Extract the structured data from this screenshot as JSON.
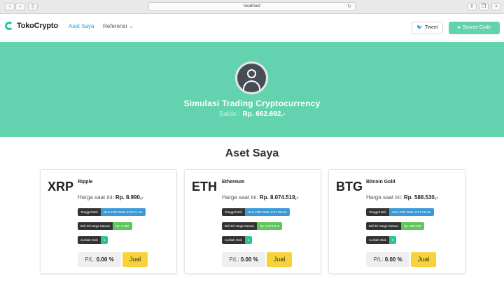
{
  "browser": {
    "address": "localhost"
  },
  "nav": {
    "logo": "TokoCrypto",
    "links": [
      "Aset Saya",
      "Referensi"
    ],
    "tweet": "Tweet",
    "source": "Source Code"
  },
  "hero": {
    "title": "Simulasi Trading Cryptocurrency",
    "saldo_label": "Saldo :",
    "saldo_value": "Rp. 662.692,-"
  },
  "section_title": "Aset Saya",
  "labels": {
    "price": "Harga saat ini:",
    "date": "Tanggal Beli",
    "buy_price": "Beli Di Harga Satuan",
    "count": "Jumlah Stok",
    "pl": "P/L:",
    "sell": "Jual"
  },
  "assets": [
    {
      "symbol": "XRP",
      "name": "Ripple",
      "price": "Rp. 8.990,-",
      "date": "June 10th 2018, 8:20:47 am",
      "buy_price": "Rp. 8.990",
      "count": "1",
      "pl": "0.00 %"
    },
    {
      "symbol": "ETH",
      "name": "Ethereum",
      "price": "Rp. 8.074.519,-",
      "date": "June 10th 2018, 8:21:08 am",
      "buy_price": "Rp. 8.074.519",
      "count": "1",
      "pl": "0.00 %"
    },
    {
      "symbol": "BTG",
      "name": "Bitcoin Gold",
      "price": "Rp. 588.530,-",
      "date": "June 10th 2018, 8:21:28 am",
      "buy_price": "Rp. 588.530",
      "count": "1",
      "pl": "0.00 %"
    }
  ],
  "colors": {
    "accent": "#62d3ae",
    "link": "#2b9cd8",
    "sell": "#f7d238"
  }
}
